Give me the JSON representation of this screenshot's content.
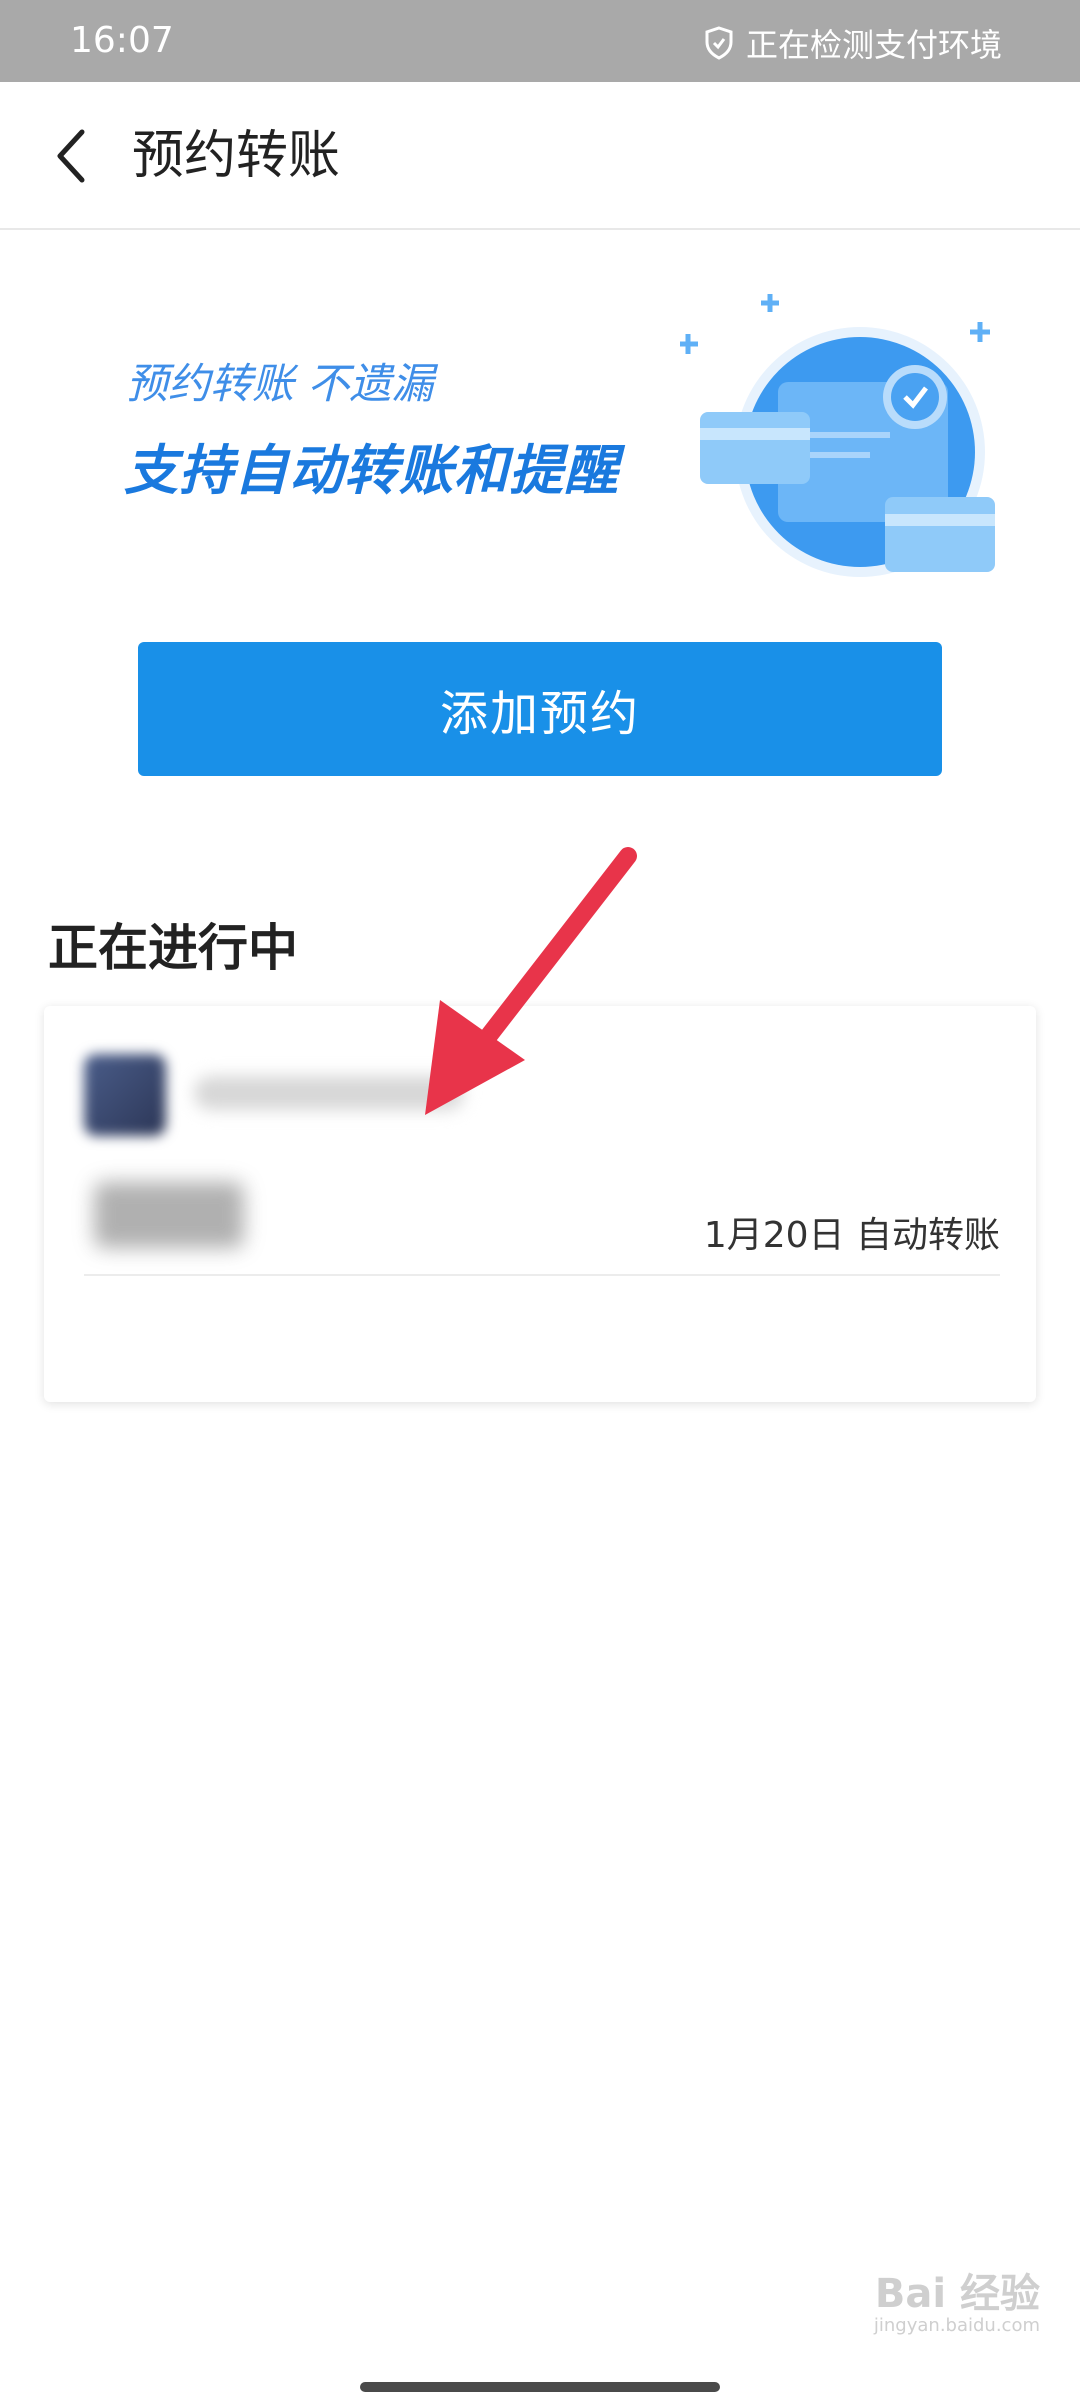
{
  "status_bar": {
    "time": "16:07",
    "security_text": "正在检测支付环境",
    "security_icon": "shield-icon"
  },
  "nav": {
    "back_icon": "chevron-left-icon",
    "title": "预约转账"
  },
  "banner": {
    "line1": "预约转账 不遗漏",
    "line2": "支持自动转账和提醒",
    "illustration_icon": "card-transfer-clock-illustration"
  },
  "actions": {
    "add_label": "添加预约"
  },
  "section": {
    "title": "正在进行中"
  },
  "card": {
    "date_text": "1月20日 自动转账"
  },
  "annotation": {
    "arrow_color": "#e8344a"
  },
  "watermark": {
    "brand": "Bai 经验",
    "url": "jingyan.baidu.com"
  },
  "colors": {
    "primary": "#1990e8",
    "status_bar": "#a9a9a9"
  }
}
